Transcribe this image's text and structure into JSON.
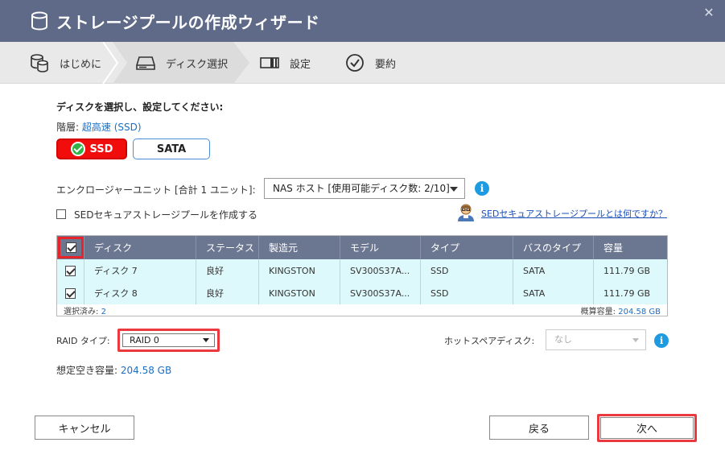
{
  "window": {
    "title": "ストレージプールの作成ウィザード",
    "close_glyph": "✕"
  },
  "steps": [
    {
      "label": "はじめに",
      "icon": "database-icon"
    },
    {
      "label": "ディスク選択",
      "icon": "disk-drive-icon"
    },
    {
      "label": "設定",
      "icon": "settings-panel-icon"
    },
    {
      "label": "要約",
      "icon": "check-circle-icon"
    }
  ],
  "content": {
    "heading": "ディスクを選択し、設定してください:",
    "tier_label": "階層:",
    "tier_value": "超高速 (SSD)",
    "tab_ssd": "SSD",
    "tab_sata": "SATA",
    "enclosure_label": "エンクロージャーユニット [合計 1 ユニット]:",
    "enclosure_value": "NAS ホスト [使用可能ディスク数: 2/10]",
    "sed_label": "SEDセキュアストレージプールを作成する",
    "sed_link": "SEDセキュアストレージプールとは何ですか？",
    "info_glyph": "i"
  },
  "table": {
    "headers": [
      "ディスク",
      "ステータス",
      "製造元",
      "モデル",
      "タイプ",
      "バスのタイプ",
      "容量"
    ],
    "rows": [
      [
        "ディスク 7",
        "良好",
        "KINGSTON",
        "SV300S37A...",
        "SSD",
        "SATA",
        "111.79 GB"
      ],
      [
        "ディスク 8",
        "良好",
        "KINGSTON",
        "SV300S37A...",
        "SSD",
        "SATA",
        "111.79 GB"
      ]
    ],
    "selected_label": "選択済み:",
    "selected_count": "2",
    "total_label": "概算容量:",
    "total_value": "204.58 GB"
  },
  "raid": {
    "label": "RAID タイプ:",
    "value": "RAID 0",
    "hotspare_label": "ホットスペアディスク:",
    "hotspare_value": "なし",
    "est_label": "想定空き容量:",
    "est_value": "204.58 GB"
  },
  "buttons": {
    "cancel": "キャンセル",
    "back": "戻る",
    "next": "次へ"
  }
}
